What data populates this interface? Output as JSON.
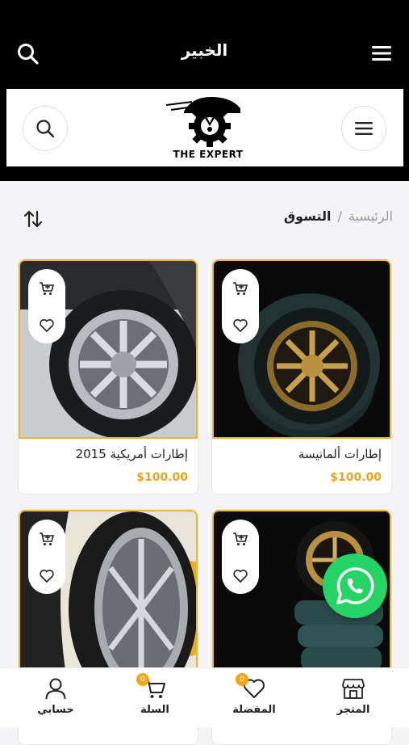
{
  "header": {
    "title": "الخبير"
  },
  "brand": {
    "logo_text": "THE EXPERT"
  },
  "breadcrumb": {
    "home": "الرئيسية",
    "separator": "/",
    "current": "التسوق"
  },
  "products": [
    {
      "name": "إطارات ألمانيسة",
      "price": "$100.00"
    },
    {
      "name": "إطارات أمريكية 2015",
      "price": "$100.00"
    },
    {
      "name": "",
      "price": ""
    },
    {
      "name": "",
      "price": ""
    }
  ],
  "bottom_nav": {
    "store": "المتجر",
    "favorites": "المفضلة",
    "favorites_count": "0",
    "cart": "السلة",
    "cart_count": "0",
    "account": "حسابي"
  },
  "colors": {
    "accent": "#e8a41c",
    "whatsapp": "#25d366"
  }
}
